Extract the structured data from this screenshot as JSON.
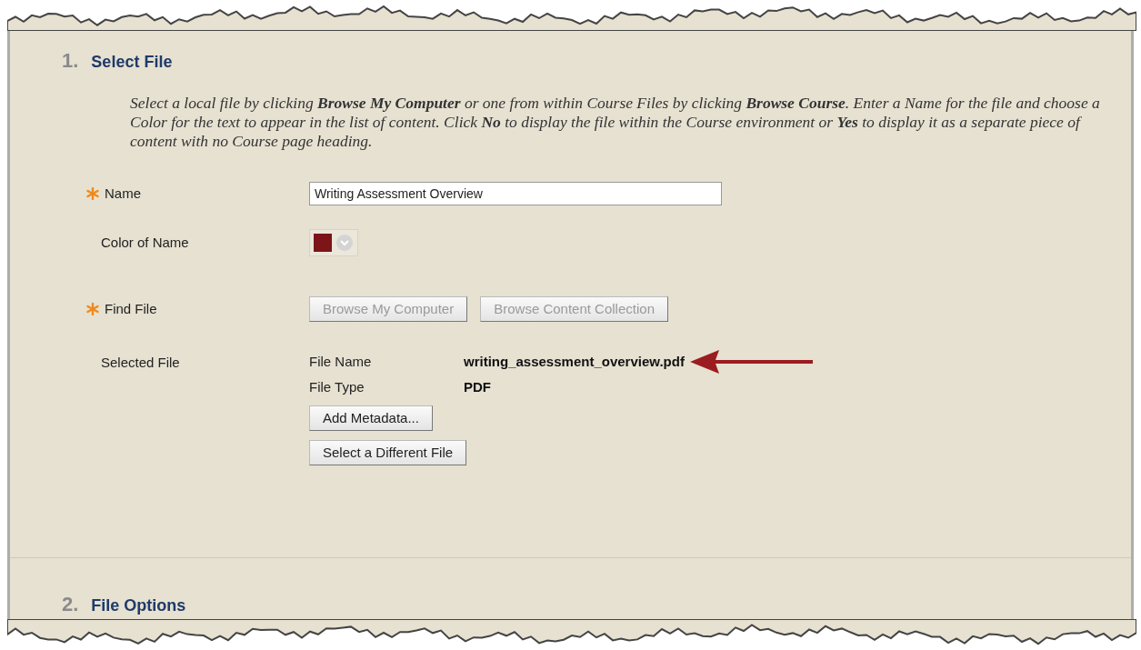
{
  "sections": [
    {
      "number": "1.",
      "title": "Select File"
    },
    {
      "number": "2.",
      "title": "File Options"
    }
  ],
  "instructions": "Select a local file by clicking **Browse My Computer** or one from within Course Files by clicking **Browse Course**. Enter a Name for the file and choose a Color for the text to appear in the list of content. Click **No** to display the file within the Course environment or **Yes** to display it as a separate piece of content with no Course page heading.",
  "name_field": {
    "label": "Name",
    "required": true,
    "value": "Writing Assessment Overview"
  },
  "color_field": {
    "label": "Color of Name",
    "required": false,
    "color": "#7b1518"
  },
  "find_file": {
    "label": "Find File",
    "required": true,
    "buttons": [
      {
        "label": "Browse My Computer",
        "disabled": true
      },
      {
        "label": "Browse Content Collection",
        "disabled": true
      }
    ]
  },
  "selected_file": {
    "label": "Selected File",
    "details": [
      {
        "label": "File Name",
        "value": "writing_assessment_overview.pdf",
        "highlighted": true
      },
      {
        "label": "File Type",
        "value": "PDF",
        "highlighted": false
      }
    ],
    "buttons": [
      {
        "label": "Add Metadata...",
        "disabled": false
      },
      {
        "label": "Select a Different File",
        "disabled": false
      }
    ]
  }
}
